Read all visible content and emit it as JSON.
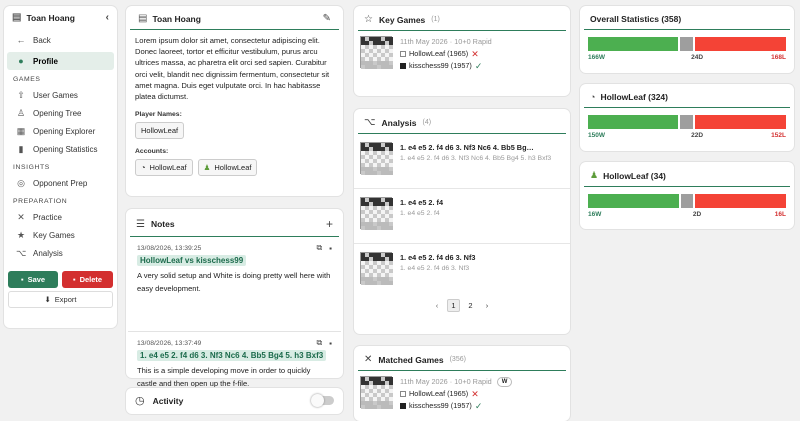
{
  "sidebar": {
    "title": "Toan Hoang",
    "back": "Back",
    "profile": "Profile",
    "sections": [
      "GAMES",
      "INSIGHTS",
      "PREPARATION"
    ],
    "games_items": [
      "User Games",
      "Opening Tree",
      "Opening Explorer",
      "Opening Statistics"
    ],
    "insights_items": [
      "Opponent Prep"
    ],
    "prep_items": [
      "Practice",
      "Key Games",
      "Analysis"
    ],
    "save": "Save",
    "delete": "Delete",
    "export": "Export"
  },
  "profile": {
    "name": "Toan Hoang",
    "bio": "Lorem ipsum dolor sit amet, consectetur adipiscing elit. Donec laoreet, tortor et efficitur vestibulum, purus arcu ultrices massa, ac pharetra elit orci sed sapien. Curabitur orci velit, blandit nec dignissim fermentum, consectetur sit amet magna. Duis eget vulputate orci. In hac habitasse platea dictumst.",
    "player_names_label": "Player Names:",
    "player_names": [
      "HollowLeaf"
    ],
    "accounts_label": "Accounts:",
    "accounts": [
      "HollowLeaf",
      "HollowLeaf"
    ]
  },
  "notes": {
    "title": "Notes",
    "items": [
      {
        "time": "13/08/2026, 13:39:25",
        "tag": "HollowLeaf vs kisschess99",
        "text": "A very solid setup and White is doing pretty well here with easy development."
      },
      {
        "time": "13/08/2026, 13:37:49",
        "tag": "1. e4 e5 2. f4 d6 3. Nf3 Nc6 4. Bb5 Bg4 5. h3 Bxf3",
        "text": "This is a simple developing move in order to quickly castle and then open up the f-file."
      }
    ]
  },
  "activity": {
    "title": "Activity"
  },
  "key_games": {
    "title": "Key Games",
    "count": "(1)",
    "game": {
      "date": "11th May 2026 · 10+0 Rapid",
      "white": "HollowLeaf (1965)",
      "black": "kisschess99 (1957)"
    }
  },
  "analysis": {
    "title": "Analysis",
    "count": "(4)",
    "items": [
      {
        "title": "1. e4 e5 2. f4 d6 3. Nf3 Nc6 4. Bb5 Bg…",
        "sub": "1. e4 e5 2. f4 d6 3. Nf3 Nc6 4. Bb5 Bg4 5. h3 Bxf3"
      },
      {
        "title": "1. e4 e5 2. f4",
        "sub": "1. e4 e5 2. f4"
      },
      {
        "title": "1. e4 e5 2. f4 d6 3. Nf3",
        "sub": "1. e4 e5 2. f4 d6 3. Nf3"
      }
    ],
    "pages": [
      "1",
      "2"
    ]
  },
  "matched_games": {
    "title": "Matched Games",
    "count": "(356)",
    "game": {
      "date": "11th May 2026 · 10+0 Rapid",
      "badge": "W",
      "white": "HollowLeaf (1965)",
      "black": "kisschess99 (1957)"
    }
  },
  "stats": [
    {
      "title": "Overall Statistics (358)",
      "w": "166W",
      "d": "24D",
      "l": "168L",
      "wv": 166,
      "dv": 24,
      "lv": 168
    },
    {
      "title": "HollowLeaf (324)",
      "w": "150W",
      "d": "22D",
      "l": "152L",
      "wv": 150,
      "dv": 22,
      "lv": 152
    },
    {
      "title": "HollowLeaf (34)",
      "w": "16W",
      "d": "2D",
      "l": "16L",
      "wv": 16,
      "dv": 2,
      "lv": 16
    }
  ],
  "colors": {
    "accent": "#2e7d5b",
    "win": "#4caf50",
    "draw": "#9e9e9e",
    "loss": "#f44336",
    "save": "#2e7d5b",
    "delete": "#d32f2f"
  }
}
